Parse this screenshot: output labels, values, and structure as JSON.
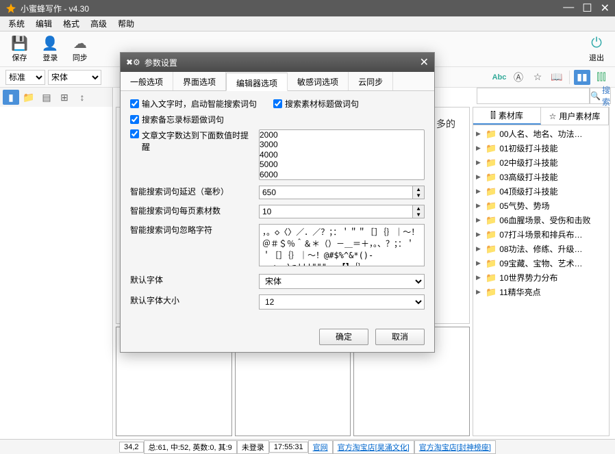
{
  "titlebar": {
    "title": "小蜜蜂写作 - v4.30"
  },
  "menubar": [
    "系统",
    "编辑",
    "格式",
    "高级",
    "帮助"
  ],
  "toolbar_big": {
    "save": "保存",
    "login": "登录",
    "sync": "同步",
    "exit": "退出"
  },
  "toolbar_sm": {
    "style": "标准",
    "font": "宋体"
  },
  "search": {
    "placeholder": "",
    "button": "搜索"
  },
  "right_tabs": {
    "lib": "素材库",
    "user_lib": "用户素材库"
  },
  "tree": [
    "00人名、地名、功法…",
    "01初级打斗技能",
    "02中级打斗技能",
    "03高级打斗技能",
    "04顶级打斗技能",
    "05气势、势场",
    "06血腥场景、受伤和击败",
    "07打斗场景和排兵布…",
    "08功法、修练、升级…",
    "09宝藏、宝物、艺术…",
    "10世界势力分布",
    "11精华亮点"
  ],
  "editor_text": "多的",
  "statusbar": {
    "pos": "34,2",
    "stats": "总:61, 中:52, 英数:0, 其:9",
    "login": "未登录",
    "time": "17:55:31",
    "links": [
      "官网",
      "官方淘宝店[昊涌文化]",
      "官方淘宝店[封神榜座]"
    ]
  },
  "dialog": {
    "title": "参数设置",
    "tabs": [
      "一般选项",
      "界面选项",
      "编辑器选项",
      "敏感词选项",
      "云同步"
    ],
    "chk1": "输入文字时，启动智能搜索词句",
    "chk2": "搜索素材标题做词句",
    "chk3": "搜索备忘录标题做词句",
    "chk4": "文章文字数达到下面数值时提醒",
    "word_counts": [
      "2000",
      "3000",
      "4000",
      "5000",
      "6000"
    ],
    "delay_label": "智能搜索词句延迟（毫秒）",
    "delay_value": "650",
    "perpage_label": "智能搜索词句每页素材数",
    "perpage_value": "10",
    "ignore_label": "智能搜索词句忽略字符",
    "ignore_value": "，。◇〈〉／．／？；：＇＂＂［］｛｝｜～！＠＃＄％＾＆＊（）－＿＝＋，。、？；：＇＇［］｛｝｜～！@#$%^&*()-=_+,.\\n'''\"\"\"…—·【】｛｝、",
    "font_label": "默认字体",
    "font_value": "宋体",
    "fontsize_label": "默认字体大小",
    "fontsize_value": "12",
    "ok": "确定",
    "cancel": "取消"
  }
}
